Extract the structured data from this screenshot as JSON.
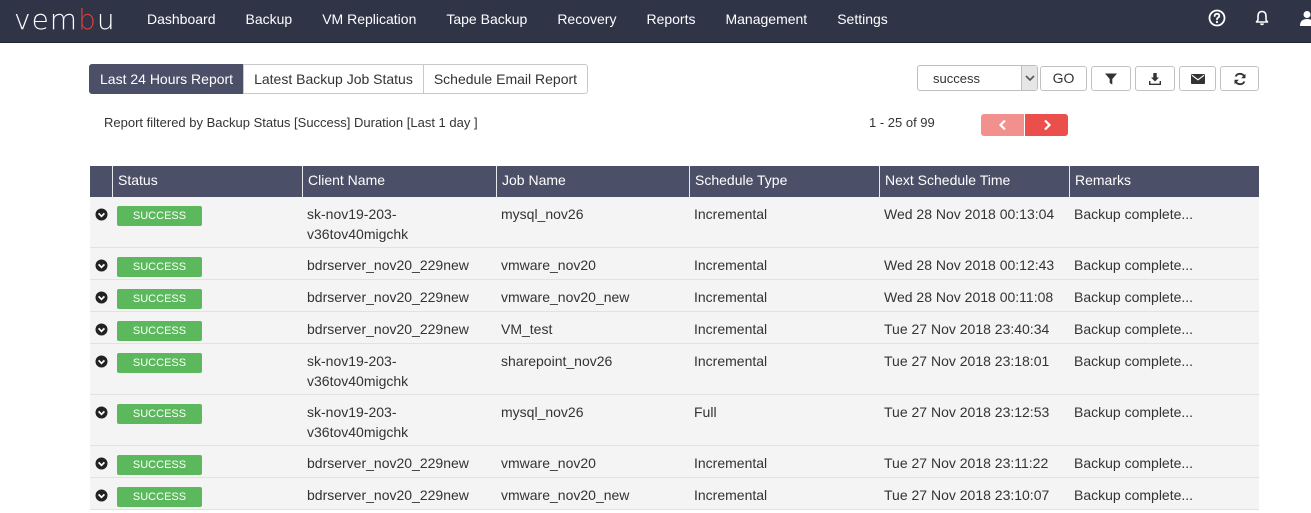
{
  "brand": {
    "logo_pre": "vem",
    "logo_accent": "b",
    "logo_post": "u",
    "accent_color": "#e23b3b",
    "nav_bg": "#2f3447"
  },
  "nav": {
    "items": [
      "Dashboard",
      "Backup",
      "VM Replication",
      "Tape Backup",
      "Recovery",
      "Reports",
      "Management",
      "Settings"
    ],
    "icons": [
      "help-icon",
      "bell-icon",
      "user-icon"
    ]
  },
  "report_tabs": [
    {
      "label": "Last 24 Hours Report",
      "active": true
    },
    {
      "label": "Latest Backup Job Status",
      "active": false
    },
    {
      "label": "Schedule Email Report",
      "active": false
    }
  ],
  "toolbar": {
    "status_filter": "success",
    "go_label": "GO",
    "icons": [
      "filter-icon",
      "download-icon",
      "email-icon",
      "refresh-icon"
    ]
  },
  "filter_info": "Report filtered by Backup Status [Success] Duration [Last 1 day ]",
  "pagination": {
    "text": "1 - 25 of 99",
    "prev_color": "#f2908d",
    "next_color": "#ea4f4b"
  },
  "table": {
    "columns": [
      "Status",
      "Client Name",
      "Job Name",
      "Schedule Type",
      "Next Schedule Time",
      "Remarks"
    ],
    "status_color": "#5cb85c",
    "rows": [
      {
        "status": "SUCCESS",
        "client": [
          "sk-nov19-203-",
          "v36tov40migchk"
        ],
        "job": "mysql_nov26",
        "schedule": "Incremental",
        "next_time": "Wed 28 Nov 2018 00:13:04",
        "remarks": "Backup complete..."
      },
      {
        "status": "SUCCESS",
        "client": [
          "bdrserver_nov20_229new"
        ],
        "job": "vmware_nov20",
        "schedule": "Incremental",
        "next_time": "Wed 28 Nov 2018 00:12:43",
        "remarks": "Backup complete..."
      },
      {
        "status": "SUCCESS",
        "client": [
          "bdrserver_nov20_229new"
        ],
        "job": "vmware_nov20_new",
        "schedule": "Incremental",
        "next_time": "Wed 28 Nov 2018 00:11:08",
        "remarks": "Backup complete..."
      },
      {
        "status": "SUCCESS",
        "client": [
          "bdrserver_nov20_229new"
        ],
        "job": "VM_test",
        "schedule": "Incremental",
        "next_time": "Tue 27 Nov 2018 23:40:34",
        "remarks": "Backup complete..."
      },
      {
        "status": "SUCCESS",
        "client": [
          "sk-nov19-203-",
          "v36tov40migchk"
        ],
        "job": "sharepoint_nov26",
        "schedule": "Incremental",
        "next_time": "Tue 27 Nov 2018 23:18:01",
        "remarks": "Backup complete..."
      },
      {
        "status": "SUCCESS",
        "client": [
          "sk-nov19-203-",
          "v36tov40migchk"
        ],
        "job": "mysql_nov26",
        "schedule": "Full",
        "next_time": "Tue 27 Nov 2018 23:12:53",
        "remarks": "Backup complete..."
      },
      {
        "status": "SUCCESS",
        "client": [
          "bdrserver_nov20_229new"
        ],
        "job": "vmware_nov20",
        "schedule": "Incremental",
        "next_time": "Tue 27 Nov 2018 23:11:22",
        "remarks": "Backup complete..."
      },
      {
        "status": "SUCCESS",
        "client": [
          "bdrserver_nov20_229new"
        ],
        "job": "vmware_nov20_new",
        "schedule": "Incremental",
        "next_time": "Tue 27 Nov 2018 23:10:07",
        "remarks": "Backup complete..."
      }
    ]
  }
}
